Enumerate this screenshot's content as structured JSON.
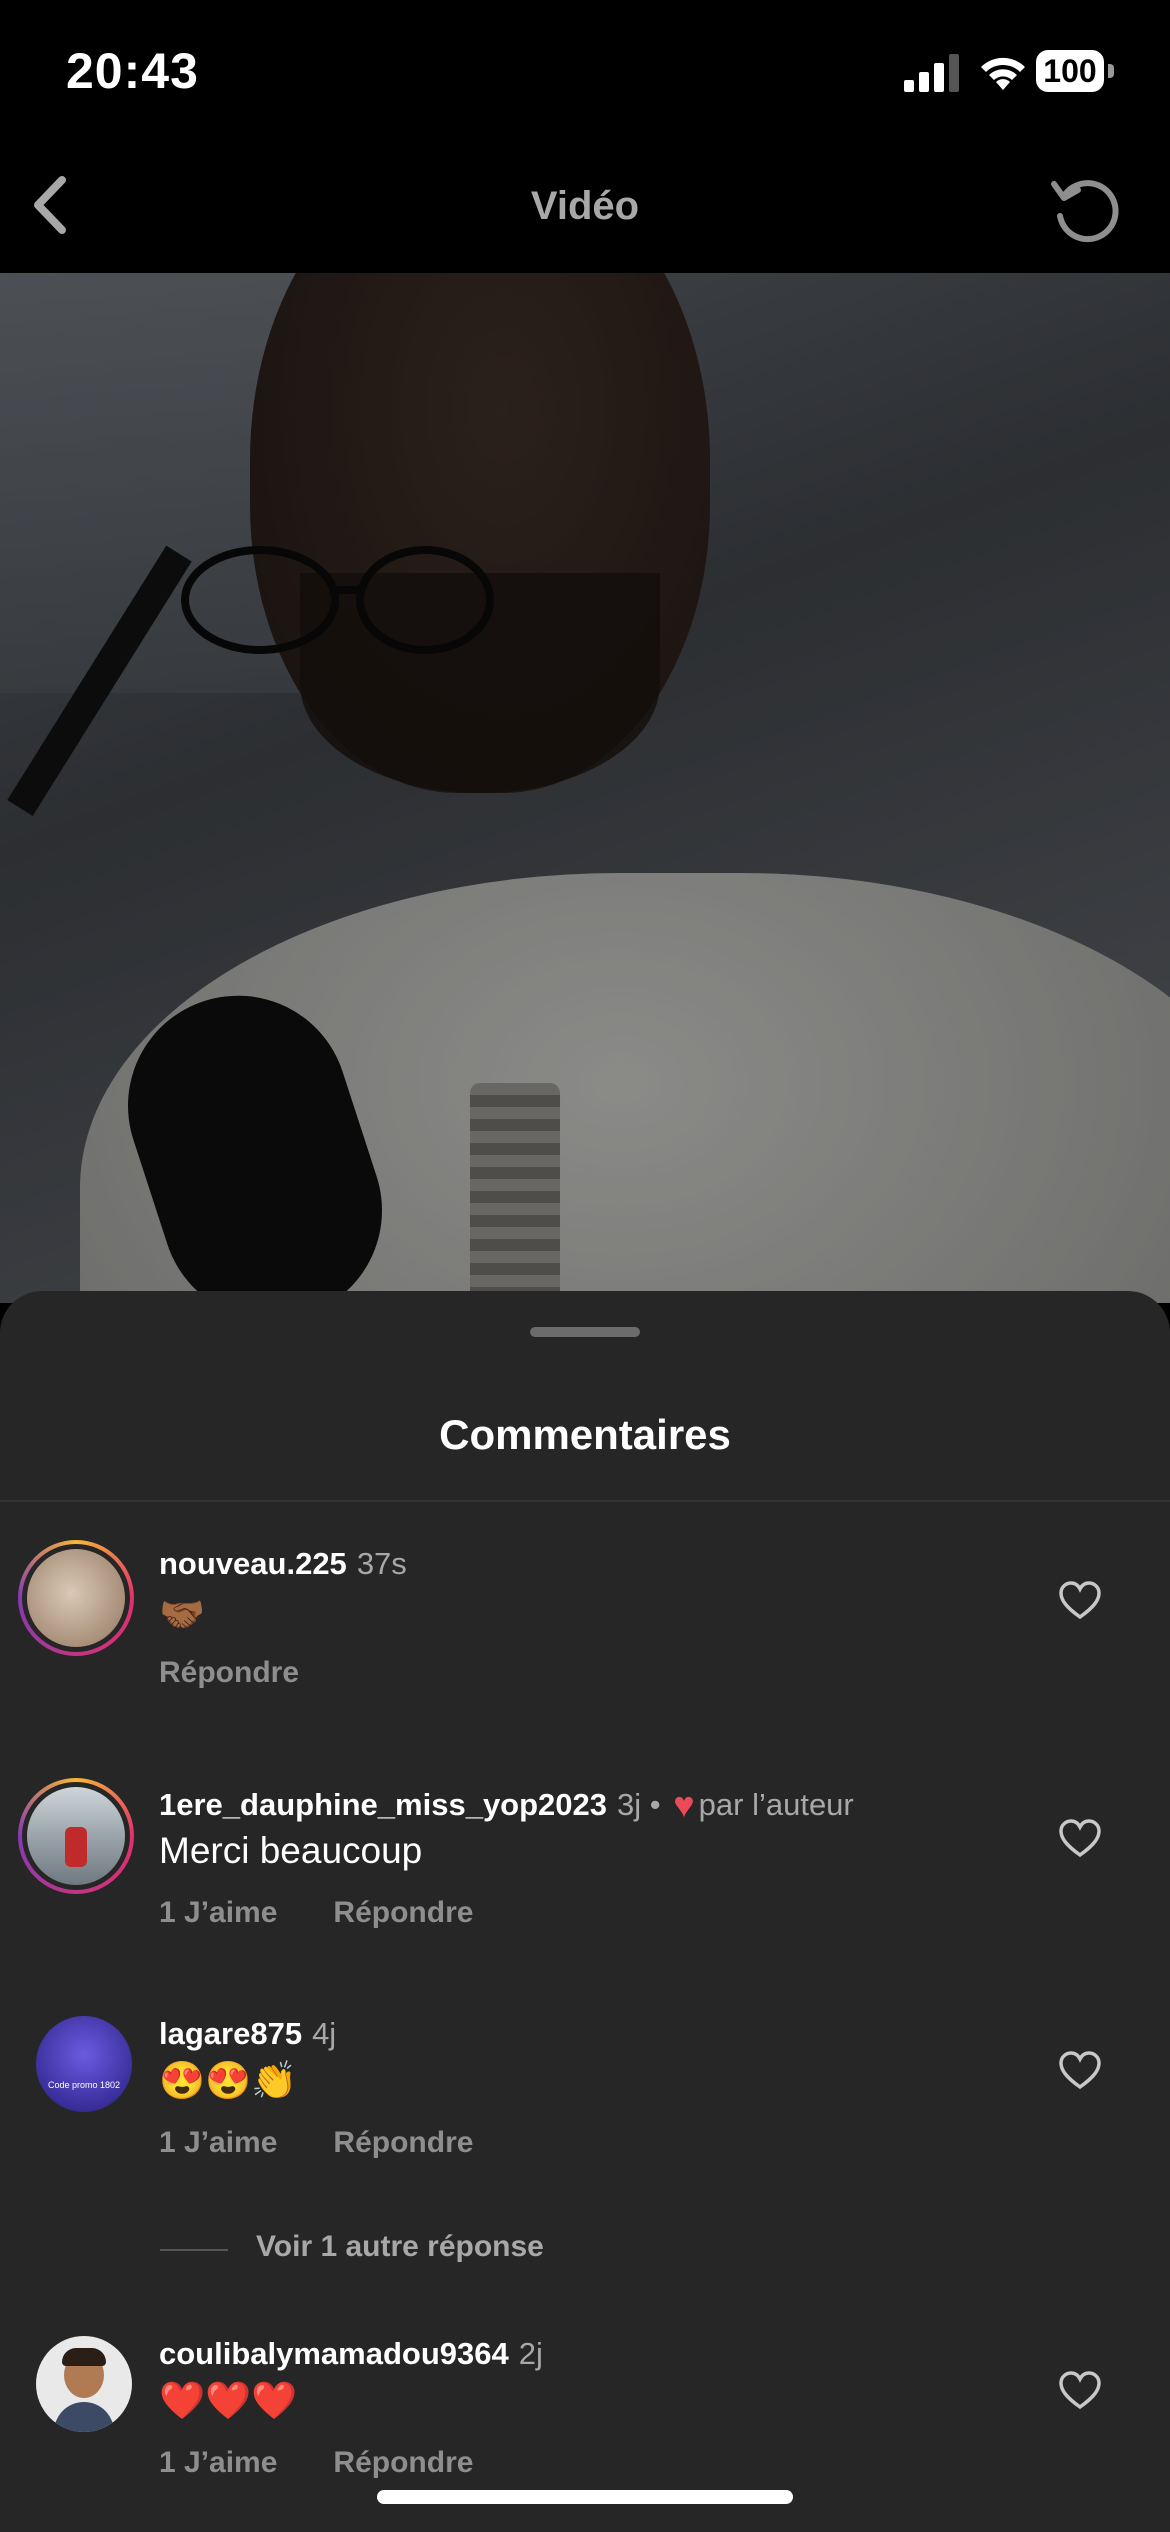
{
  "status_bar": {
    "time": "20:43",
    "battery": "100"
  },
  "nav": {
    "title": "Vidéo"
  },
  "sheet": {
    "title": "Commentaires"
  },
  "comments": [
    {
      "username": "nouveau.225",
      "time": "37s",
      "text": "🤝🏾",
      "likes": "",
      "reply": "Répondre",
      "liked_by_author": false
    },
    {
      "username": "1ere_dauphine_miss_yop2023",
      "time": "3j",
      "separator": "•",
      "author_label": "par l’auteur",
      "text": "Merci beaucoup",
      "likes": "1 J’aime",
      "reply": "Répondre",
      "liked_by_author": true
    },
    {
      "username": "lagare875",
      "time": "4j",
      "text": "😍😍👏",
      "likes": "1 J’aime",
      "reply": "Répondre",
      "liked_by_author": false,
      "avatar_caption": "Code promo 1802"
    },
    {
      "username": "coulibalymamadou9364",
      "time": "2j",
      "text": "❤️❤️❤️",
      "likes": "1 J’aime",
      "reply": "Répondre",
      "liked_by_author": false
    }
  ],
  "view_replies": "Voir 1 autre réponse",
  "colors": {
    "sheet_bg": "#262626",
    "secondary_text": "#a8a8a8",
    "heart_red": "#ed4956"
  },
  "icons": {
    "back": "chevron-left-icon",
    "refresh": "refresh-icon",
    "like": "heart-outline-icon"
  }
}
